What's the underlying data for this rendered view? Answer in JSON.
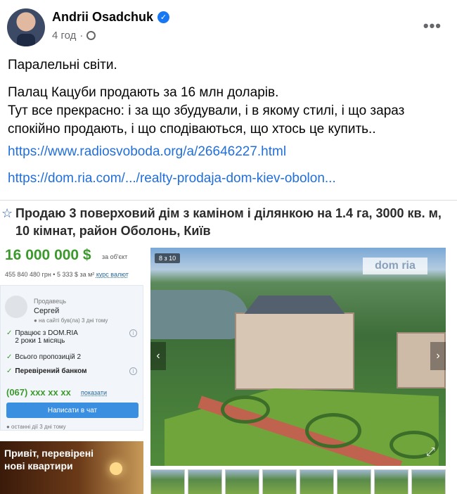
{
  "post": {
    "author": "Andrii Osadchuk",
    "time": "4 год",
    "separator": "·",
    "more": "•••",
    "line1": "Паралельні світи.",
    "line2": "Палац Кацуби продають за 16 млн доларів.",
    "line3": "Тут все прекрасно: і за що збудували, і в якому стилі, і що зараз спокійно продають, і що сподіваються, що хтось це купить..",
    "link1": "https://www.radiosvoboda.org/a/26646227.html",
    "link2": "https://dom.ria.com/.../realty-prodaja-dom-kiev-obolon..."
  },
  "listing": {
    "title": "Продаю 3 поверховий дім з каміном і ділянкою на 1.4 га, 3000 кв. м, 10 кімнат, район Оболонь, Київ",
    "price": "16 000 000 $",
    "price_note": "за об'єкт",
    "uah": "455 840 480 грн • 5 333 $ за м²",
    "currency_link": "курс валют",
    "seller_label": "Продавець",
    "seller_name": "Сергей",
    "seller_online": "● на сайті був(ла) 3 дні тому",
    "row1": "Працює з DOM.RIA",
    "row1b": "2 роки 1 місяць",
    "row2": "Всього пропозицій 2",
    "row3": "Перевірений банком",
    "phone": "(067) xxx xx xx",
    "phone_show": "показати",
    "chat": "Написати в чат",
    "last_seen": "● останні дії 3 дні тому",
    "photo_counter": "8 з 10",
    "watermark": "dom ria",
    "ad_text": "Привіт, перевірені нові квартири"
  },
  "icons": {
    "verified": "✓",
    "check": "✓",
    "star": "☆",
    "arrow_left": "‹",
    "arrow_right": "›",
    "expand": "⤢",
    "info": "i"
  },
  "colors": {
    "link": "#216fdb",
    "price": "#3c9a2c",
    "chat_button": "#3b8fe0",
    "verified": "#1877f2"
  }
}
